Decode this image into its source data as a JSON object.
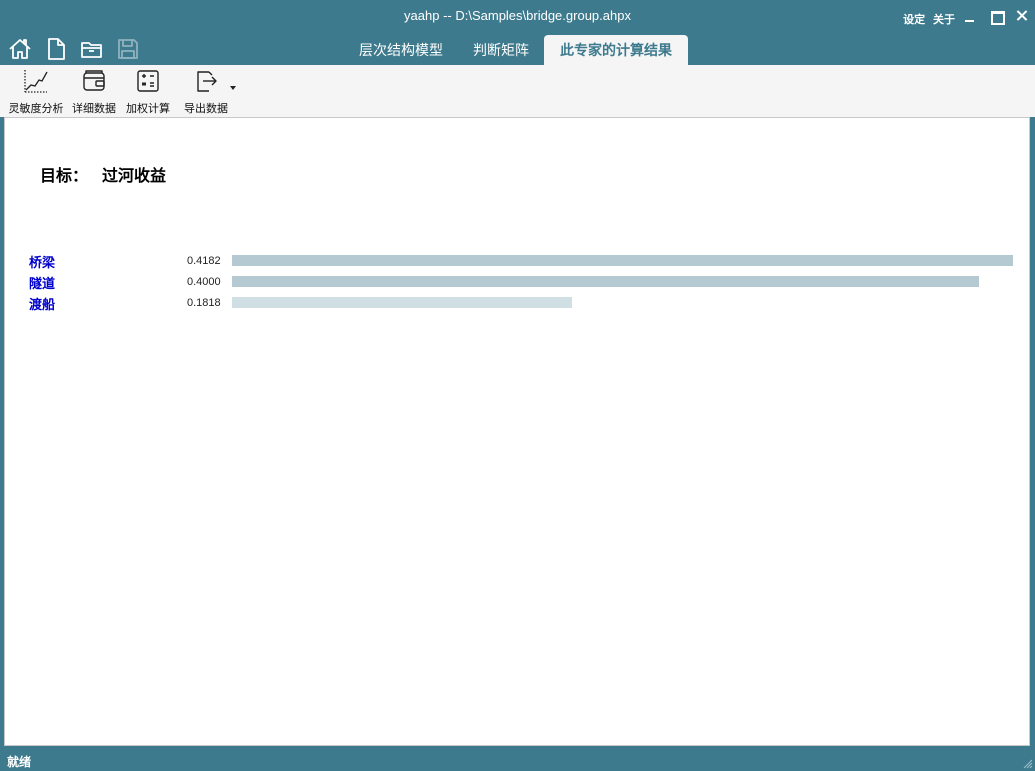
{
  "window": {
    "title": "yaahp -- D:\\Samples\\bridge.group.ahpx",
    "links": {
      "settings": "设定",
      "about": "关于"
    }
  },
  "quick_icons": [
    "home-icon",
    "new-file-icon",
    "open-folder-icon",
    "save-icon"
  ],
  "tabs": [
    {
      "label": "层次结构模型",
      "active": false
    },
    {
      "label": "判断矩阵",
      "active": false
    },
    {
      "label": "此专家的计算结果",
      "active": true
    }
  ],
  "ribbon": {
    "sensitivity": "灵敏度分析",
    "detail": "详细数据",
    "weighted": "加权计算",
    "export": "导出数据"
  },
  "goal": {
    "label": "目标：",
    "value": "过河收益"
  },
  "results": [
    {
      "name": "桥梁",
      "value": "0.4182",
      "weight": 0.4182,
      "color": "#b4c9d1"
    },
    {
      "name": "隧道",
      "value": "0.4000",
      "weight": 0.4,
      "color": "#b4c9d1"
    },
    {
      "name": "渡船",
      "value": "0.1818",
      "weight": 0.1818,
      "color": "#d0dfe4"
    }
  ],
  "status": "就绪",
  "colors": {
    "theme": "#3d7a8e",
    "link": "#0000cc"
  }
}
